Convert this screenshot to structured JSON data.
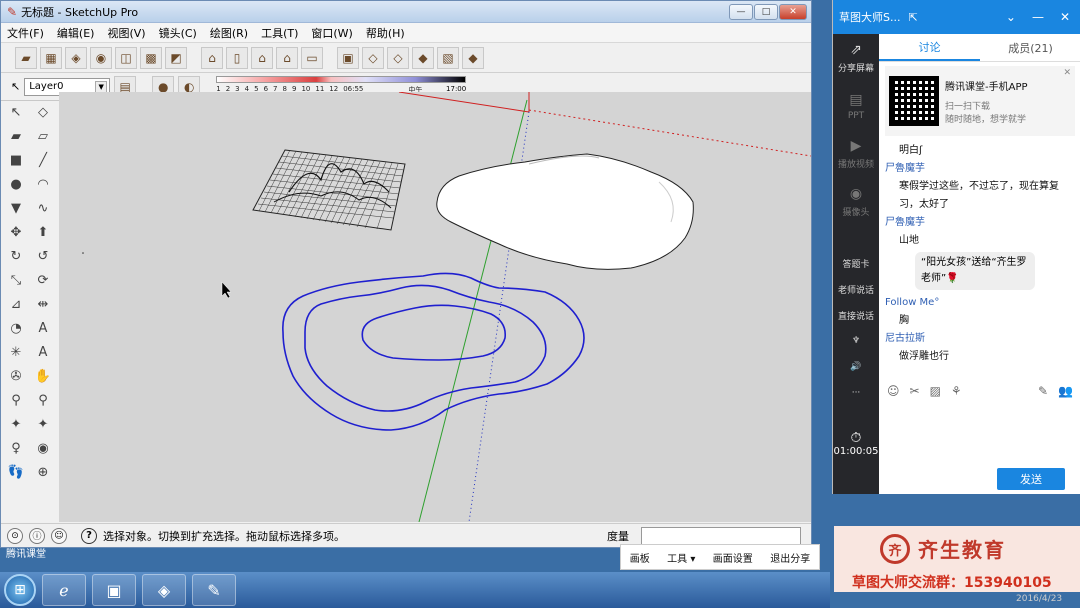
{
  "window": {
    "title": "无标题 - SketchUp Pro",
    "min": "—",
    "max": "□",
    "close": "✕"
  },
  "menu": [
    "文件(F)",
    "编辑(E)",
    "视图(V)",
    "镜头(C)",
    "绘图(R)",
    "工具(T)",
    "窗口(W)",
    "帮助(H)"
  ],
  "layer": {
    "value": "Layer0"
  },
  "shadow": {
    "labels": [
      "1",
      "2",
      "3",
      "4",
      "5",
      "6",
      "7",
      "8",
      "9",
      "10",
      "11",
      "12"
    ],
    "time1": "06:55",
    "noon": "中午",
    "time2": "17:00"
  },
  "status": {
    "text": "选择对象。切换到扩充选择。拖动鼠标选择多项。",
    "measure_label": "度量"
  },
  "share_bar": {
    "board": "画板",
    "tools": "工具 ▾",
    "settings": "画面设置",
    "exit": "退出分享"
  },
  "taskbar": {
    "desktop_label": "腾讯课堂"
  },
  "chat": {
    "header_title": "草图大师S...",
    "tabs": {
      "discuss": "讨论",
      "members": "成员(21)"
    },
    "side": {
      "share": "分享屏幕",
      "ppt": "PPT",
      "video": "播放视频",
      "camera": "摄像头",
      "answer": "答题卡",
      "teacher_talk": "老师说话",
      "direct_talk": "直接说话",
      "timer": "01:00:05"
    },
    "qr": {
      "title": "腾讯课堂-手机APP",
      "line1": "扫一扫下载",
      "line2": "随时随地，想学就学"
    },
    "messages": [
      {
        "type": "text",
        "text": "明白ʃ"
      },
      {
        "type": "name",
        "text": "尸魯魔芋"
      },
      {
        "type": "text",
        "text": "寒假学过这些，不过忘了，现在算复"
      },
      {
        "type": "text",
        "text": "习，太好了"
      },
      {
        "type": "name",
        "text": "尸魯魔芋"
      },
      {
        "type": "text",
        "text": "山地"
      },
      {
        "type": "gift",
        "text": "“阳光女孩”送给“齐生罗老师”🌹"
      },
      {
        "type": "name",
        "text": "Follow Me°"
      },
      {
        "type": "text",
        "text": "胸"
      },
      {
        "type": "name",
        "text": "尼古拉斯"
      },
      {
        "type": "text",
        "text": "做浮雕也行"
      }
    ],
    "send": "发送"
  },
  "brand": {
    "logo": "齐",
    "name": "齐生教育",
    "group": "草图大师交流群：153940105",
    "date": "2016/4/23"
  }
}
